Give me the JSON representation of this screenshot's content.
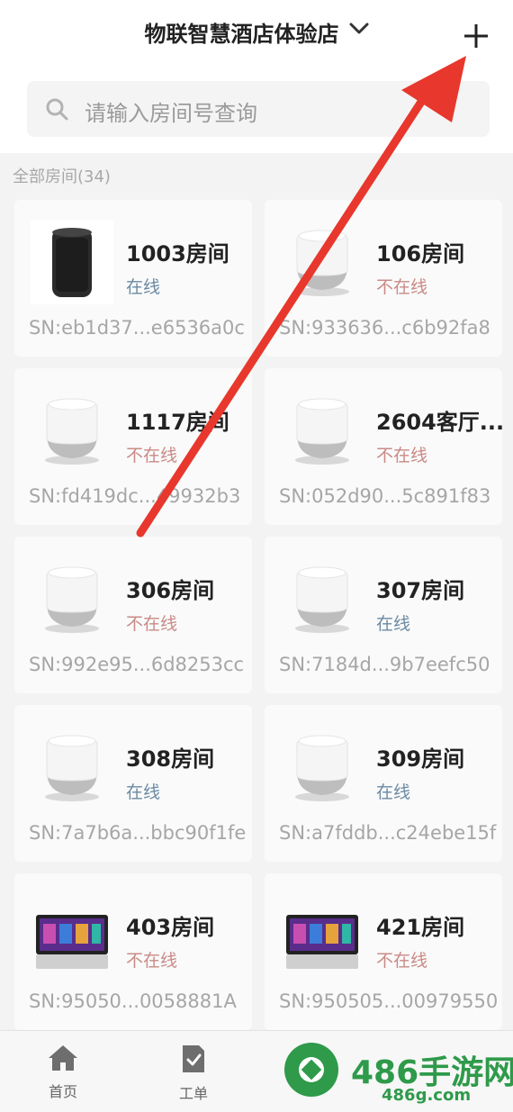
{
  "header": {
    "title": "物联智慧酒店体验店"
  },
  "search": {
    "placeholder": "请输入房间号查询"
  },
  "section": {
    "label": "全部房间(34)"
  },
  "rooms": [
    {
      "name": "1003房间",
      "status": "在线",
      "online": true,
      "sn": "SN:eb1d37...e6536a0c",
      "device": "speaker-black"
    },
    {
      "name": "106房间",
      "status": "不在线",
      "online": false,
      "sn": "SN:933636...c6b92fa8",
      "device": "speaker-white"
    },
    {
      "name": "1117房间",
      "status": "不在线",
      "online": false,
      "sn": "SN:fd419dc...49932b3",
      "device": "speaker-white"
    },
    {
      "name": "2604客厅...",
      "status": "不在线",
      "online": false,
      "sn": "SN:052d90...5c891f83",
      "device": "speaker-white"
    },
    {
      "name": "306房间",
      "status": "不在线",
      "online": false,
      "sn": "SN:992e95...6d8253cc",
      "device": "speaker-white"
    },
    {
      "name": "307房间",
      "status": "在线",
      "online": true,
      "sn": "SN:7184d...9b7eefc50",
      "device": "speaker-white"
    },
    {
      "name": "308房间",
      "status": "在线",
      "online": true,
      "sn": "SN:7a7b6a...bbc90f1fe",
      "device": "speaker-white"
    },
    {
      "name": "309房间",
      "status": "在线",
      "online": true,
      "sn": "SN:a7fddb...c24ebe15f",
      "device": "speaker-white"
    },
    {
      "name": "403房间",
      "status": "不在线",
      "online": false,
      "sn": "SN:95050...0058881A",
      "device": "smart-display"
    },
    {
      "name": "421房间",
      "status": "不在线",
      "online": false,
      "sn": "SN:950505...00979550",
      "device": "smart-display"
    }
  ],
  "tabs": [
    {
      "label": "首页",
      "icon": "home-icon"
    },
    {
      "label": "工单",
      "icon": "work-order-icon"
    }
  ],
  "watermark": {
    "text": "486手游网",
    "sub": "486g.com"
  },
  "colors": {
    "online": "#6b8aa3",
    "offline": "#c98a86",
    "arrow": "#e8372c",
    "watermark": "#2e9a4a"
  }
}
